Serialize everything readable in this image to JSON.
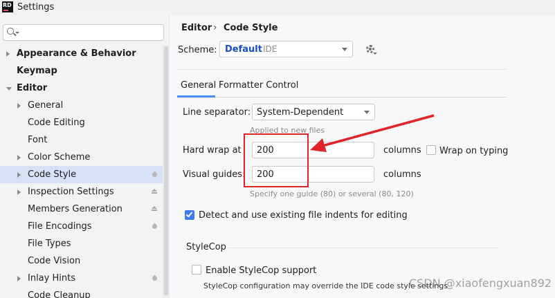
{
  "window": {
    "title": "Settings",
    "app_logo": "RD"
  },
  "search": {
    "placeholder": ""
  },
  "sidebar": {
    "items": [
      {
        "label": "Appearance & Behavior",
        "bold": true,
        "arrow": "right",
        "badge": "",
        "selected": false
      },
      {
        "label": "Keymap",
        "bold": true,
        "arrow": "",
        "badge": "",
        "selected": false
      },
      {
        "label": "Editor",
        "bold": true,
        "arrow": "down",
        "badge": "",
        "selected": false
      },
      {
        "label": "General",
        "bold": false,
        "arrow": "right",
        "badge": "",
        "selected": false
      },
      {
        "label": "Code Editing",
        "bold": false,
        "arrow": "",
        "badge": "",
        "selected": false
      },
      {
        "label": "Font",
        "bold": false,
        "arrow": "",
        "badge": "",
        "selected": false
      },
      {
        "label": "Color Scheme",
        "bold": false,
        "arrow": "right",
        "badge": "",
        "selected": false
      },
      {
        "label": "Code Style",
        "bold": false,
        "arrow": "right",
        "badge": "drop-icon",
        "selected": true
      },
      {
        "label": "Inspection Settings",
        "bold": false,
        "arrow": "right",
        "badge": "layers-icon",
        "selected": false
      },
      {
        "label": "Members Generation",
        "bold": false,
        "arrow": "",
        "badge": "layers-icon",
        "selected": false
      },
      {
        "label": "File Encodings",
        "bold": false,
        "arrow": "",
        "badge": "drop-icon",
        "selected": false
      },
      {
        "label": "File Types",
        "bold": false,
        "arrow": "",
        "badge": "",
        "selected": false
      },
      {
        "label": "Code Vision",
        "bold": false,
        "arrow": "",
        "badge": "",
        "selected": false
      },
      {
        "label": "Inlay Hints",
        "bold": false,
        "arrow": "right",
        "badge": "drop-icon",
        "selected": false
      },
      {
        "label": "Code Cleanup",
        "bold": false,
        "arrow": "",
        "badge": "",
        "selected": false
      }
    ]
  },
  "breadcrumb": {
    "parent": "Editor",
    "separator": "›",
    "current": "Code Style"
  },
  "scheme": {
    "label": "Scheme:",
    "name": "Default",
    "type": "IDE"
  },
  "tabs": [
    {
      "label": "General",
      "active": true
    },
    {
      "label": "Formatter Control",
      "active": false
    }
  ],
  "general": {
    "line_separator": {
      "label": "Line separator:",
      "value": "System-Dependent",
      "hint": "Applied to new files"
    },
    "hard_wrap": {
      "label": "Hard wrap at",
      "value": "200",
      "unit": "columns"
    },
    "wrap_on_typing": {
      "label": "Wrap on typing",
      "checked": false
    },
    "visual_guides": {
      "label": "Visual guides:",
      "value": "200",
      "unit": "columns",
      "hint": "Specify one guide (80) or several (80, 120)"
    },
    "detect_indents": {
      "label": "Detect and use existing file indents for editing",
      "checked": true
    },
    "stylecop": {
      "title": "StyleCop",
      "enable": {
        "label": "Enable StyleCop support",
        "checked": false
      },
      "note": "StyleCop configuration may override the IDE code style settings"
    }
  },
  "annotation": {
    "color": "#e0242a"
  },
  "watermark": "CSDN @xiaofengxuan892",
  "colors": {
    "accent": "#4a8ef0",
    "selection": "#d5e1f5",
    "scheme_name": "#1a4fbf"
  }
}
